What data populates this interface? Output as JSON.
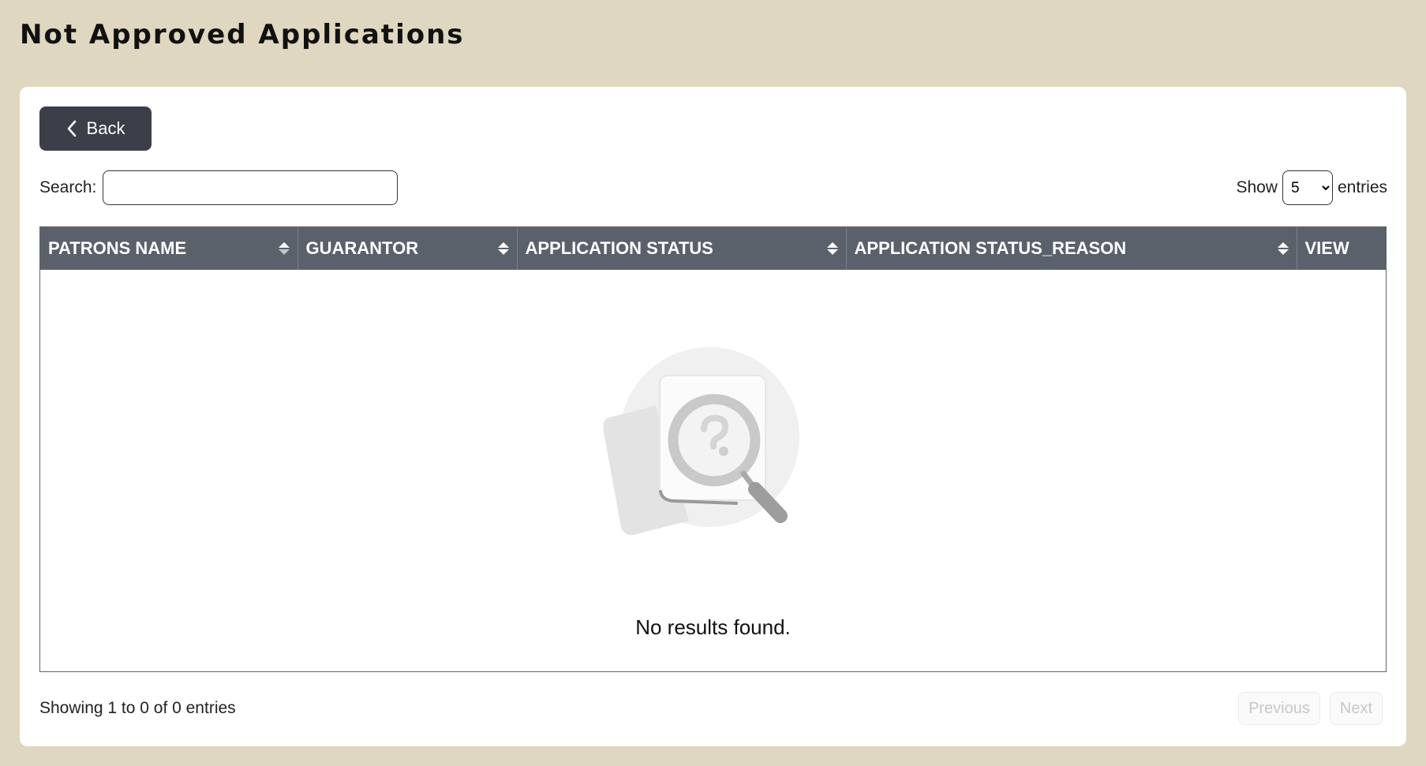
{
  "page": {
    "title": "Not Approved Applications"
  },
  "toolbar": {
    "back_label": "Back"
  },
  "search": {
    "label": "Search:",
    "value": "",
    "placeholder": ""
  },
  "length": {
    "show_label": "Show",
    "selected": "5",
    "entries_label": "entries"
  },
  "table": {
    "columns": [
      {
        "label": "PATRONS NAME",
        "sortable": true
      },
      {
        "label": "GUARANTOR",
        "sortable": true
      },
      {
        "label": "APPLICATION STATUS",
        "sortable": true
      },
      {
        "label": "APPLICATION STATUS_REASON",
        "sortable": true
      },
      {
        "label": "VIEW",
        "sortable": false
      }
    ],
    "rows": [],
    "empty_message": "No results found."
  },
  "footer": {
    "info": "Showing 1 to 0 of 0 entries",
    "previous_label": "Previous",
    "next_label": "Next"
  },
  "colors": {
    "background": "#dfd7c0",
    "header": "#5b616b",
    "button": "#3b3f49"
  },
  "icons": {
    "back": "chevron-left-icon",
    "sort": "sort-icon",
    "empty": "search-document-icon"
  }
}
